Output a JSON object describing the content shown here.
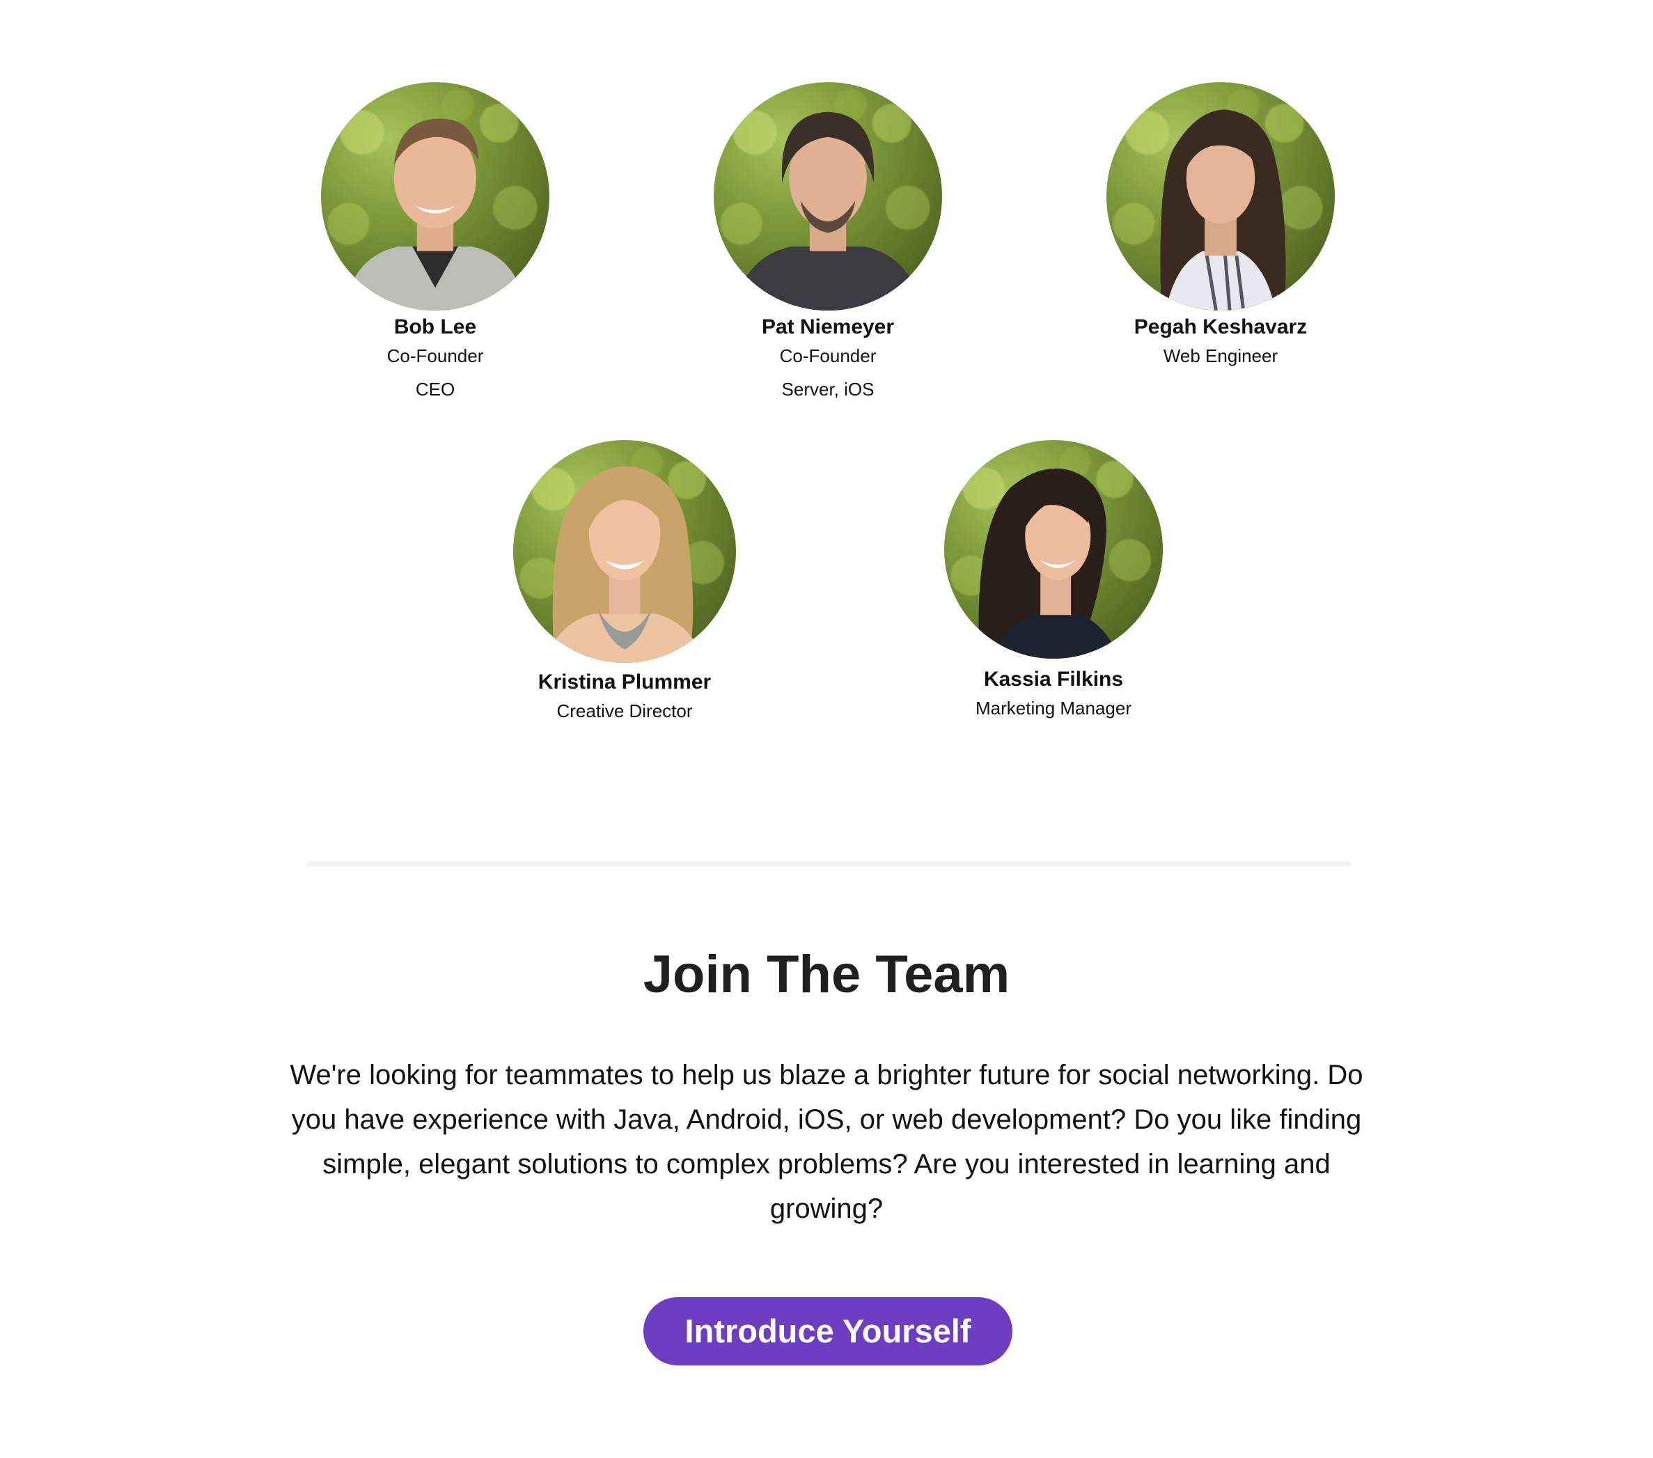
{
  "team": {
    "members": [
      {
        "name": "Bob Lee",
        "role": "Co-Founder",
        "sub": "CEO"
      },
      {
        "name": "Pat Niemeyer",
        "role": "Co-Founder",
        "sub": "Server, iOS"
      },
      {
        "name": "Pegah Keshavarz",
        "role": "Web Engineer"
      },
      {
        "name": "Kristina Plummer",
        "role": "Creative Director"
      },
      {
        "name": "Kassia Filkins",
        "role": "Marketing Manager"
      }
    ]
  },
  "join": {
    "title": "Join The Team",
    "body": "We're looking for teammates to help us blaze a brighter future for social networking. Do you have experience with Java, Android, iOS, or web development? Do you like finding simple, elegant solutions to complex problems? Are you interested in learning and growing?",
    "button_label": "Introduce Yourself"
  },
  "colors": {
    "accent": "#6d3ec4",
    "title": "#1f1f1f",
    "divider": "#f1f1f1"
  }
}
